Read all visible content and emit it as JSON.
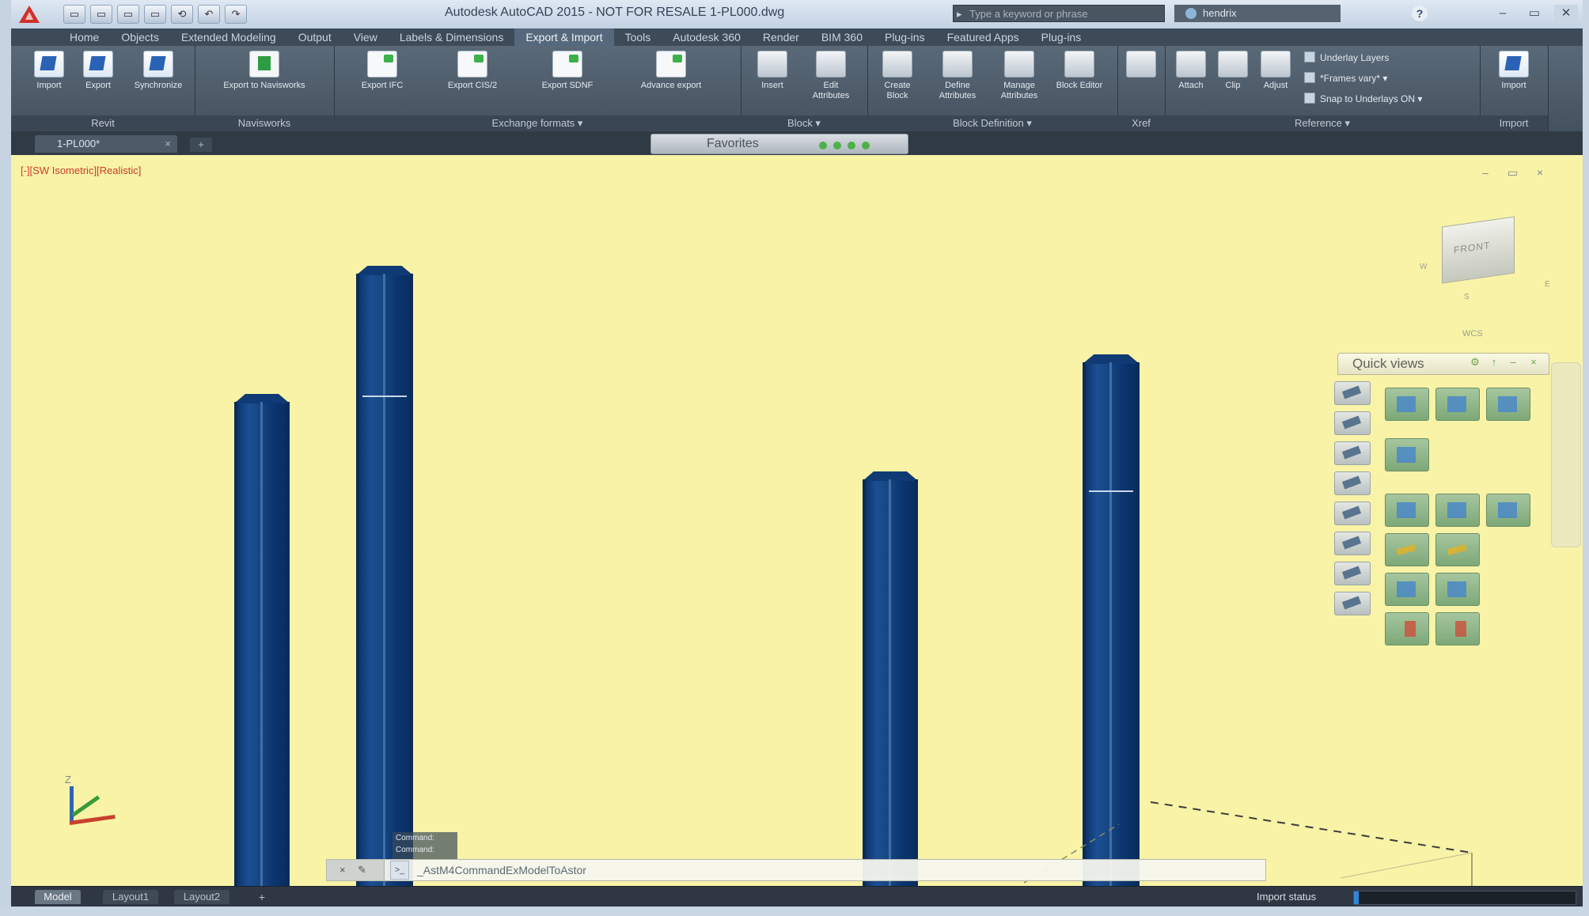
{
  "window": {
    "title": "Autodesk AutoCAD 2015 - NOT FOR RESALE 1-PL000.dwg",
    "search_placeholder": "Type a keyword or phrase",
    "user": "hendrix",
    "help": "?"
  },
  "quick_access": [
    "▭",
    "▭",
    "▭",
    "▭",
    "⟲",
    "↶",
    "↷"
  ],
  "ribbon": {
    "tabs": [
      "Home",
      "Objects",
      "Extended Modeling",
      "Output",
      "View",
      "Labels & Dimensions",
      "Export & Import",
      "Tools",
      "Autodesk 360",
      "Render",
      "BIM 360",
      "Plug-ins",
      "Featured Apps",
      "Plug-ins"
    ],
    "active_tab": "Export & Import",
    "panels": [
      {
        "id": "revit",
        "title": "Revit",
        "buttons": [
          "Import",
          "Export",
          "Synchronize"
        ]
      },
      {
        "id": "navisworks",
        "title": "Navisworks",
        "buttons": [
          "Export to Navisworks"
        ]
      },
      {
        "id": "exchange",
        "title": "Exchange formats ▾",
        "buttons": [
          "Export IFC",
          "Export CIS/2",
          "Export SDNF",
          "Advance export"
        ]
      },
      {
        "id": "block",
        "title": "Block ▾",
        "buttons": [
          "Insert",
          "Edit Attributes"
        ]
      },
      {
        "id": "block_def",
        "title": "Block Definition ▾",
        "buttons": [
          "Create Block",
          "Define Attributes",
          "Manage Attributes",
          "Block Editor"
        ]
      },
      {
        "id": "xref",
        "title": "Xref",
        "buttons": [
          ""
        ]
      },
      {
        "id": "reference",
        "title": "Reference ▾",
        "buttons": [
          "Attach",
          "Clip",
          "Adjust"
        ],
        "rows": [
          "Underlay Layers",
          "*Frames vary* ▾",
          "Snap to Underlays ON ▾"
        ]
      },
      {
        "id": "import",
        "title": "Import",
        "buttons": [
          "Import"
        ]
      }
    ]
  },
  "file_tabs": {
    "active": "1-PL000*",
    "close": "×",
    "new_tab": "+"
  },
  "favorites": {
    "label": "Favorites"
  },
  "viewport": {
    "controls": "[-][SW Isometric][Realistic]",
    "window_buttons": "– ▭ ×",
    "viewcube": {
      "face": "FRONT",
      "dirs": [
        "W",
        "S",
        "E",
        "WCS"
      ]
    },
    "ucs_z": "Z"
  },
  "quick_views": {
    "title": "Quick views",
    "controls": [
      "⚙",
      "↑",
      "–",
      "×"
    ]
  },
  "command_line": {
    "buttons": "× ✎",
    "prompt": ">_",
    "text": "_AstM4CommandExModelToAstor",
    "history": [
      "Command:",
      "Command:"
    ]
  },
  "status_bar": {
    "layout_tabs": [
      "Model",
      "Layout1",
      "Layout2"
    ],
    "add": "+",
    "status_text": "Import status",
    "progress": 0.02
  }
}
